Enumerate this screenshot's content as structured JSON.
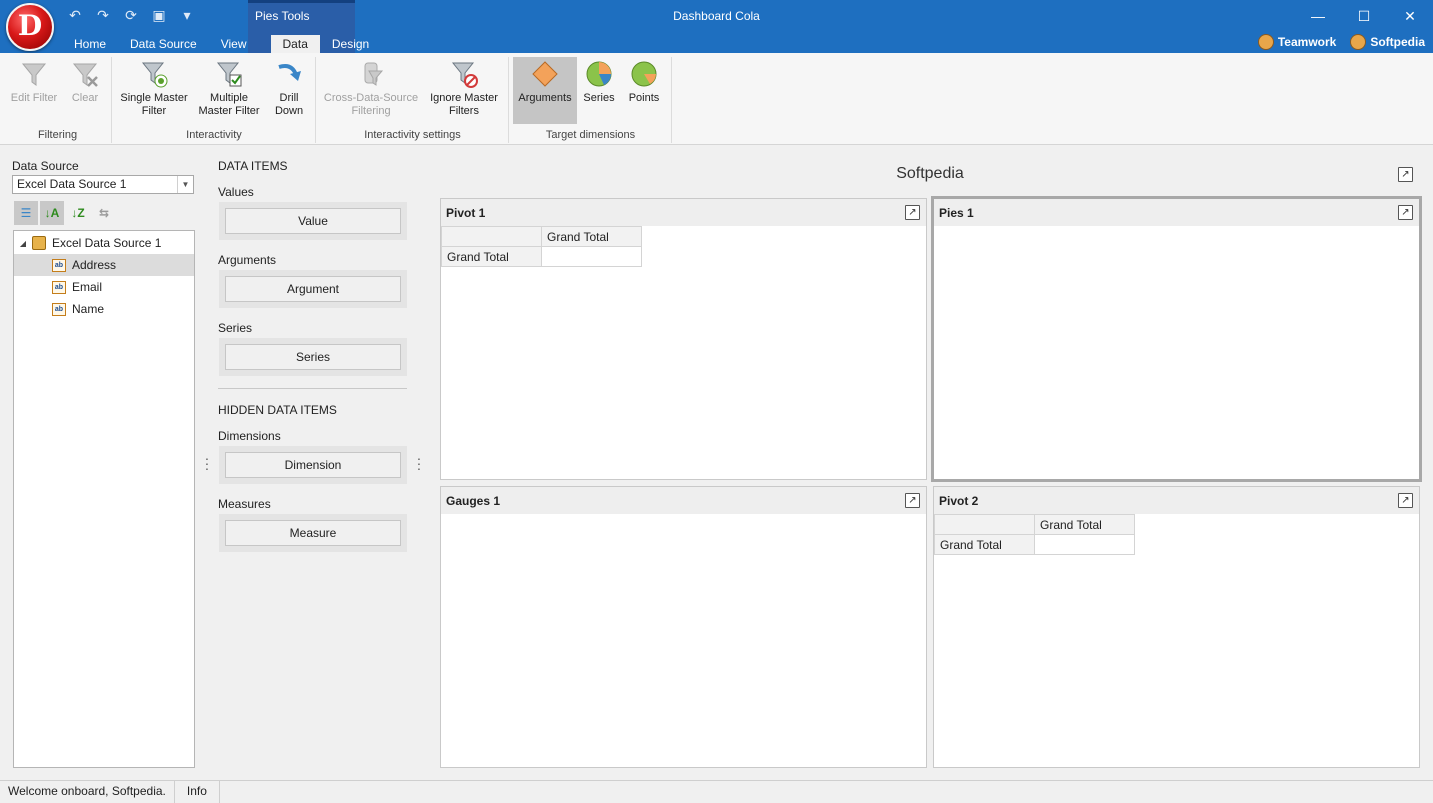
{
  "app": {
    "title": "Dashboard Cola",
    "logo_letter": "D",
    "context_group_label": "Pies Tools"
  },
  "tabs": [
    "Home",
    "Data Source",
    "View",
    "Data",
    "Design"
  ],
  "user_links": [
    "Teamwork",
    "Softpedia"
  ],
  "ribbon": {
    "groups": {
      "filtering": "Filtering",
      "interactivity": "Interactivity",
      "interactivity_settings": "Interactivity settings",
      "target_dimensions": "Target dimensions"
    },
    "buttons": {
      "edit_filter": "Edit Filter",
      "clear": "Clear",
      "single_master_filter": "Single Master Filter",
      "multiple_master_filter": "Multiple Master Filter",
      "drill_down": "Drill Down",
      "cross_data_source": "Cross-Data-Source Filtering",
      "ignore_master_filters": "Ignore Master Filters",
      "arguments": "Arguments",
      "series": "Series",
      "points": "Points"
    }
  },
  "data_source": {
    "label": "Data Source",
    "selected": "Excel Data Source 1",
    "tree_root": "Excel Data Source 1",
    "fields": [
      "Address",
      "Email",
      "Name"
    ],
    "selected_field": "Address"
  },
  "data_items": {
    "heading": "DATA ITEMS",
    "values_label": "Values",
    "values_slot": "Value",
    "arguments_label": "Arguments",
    "arguments_slot": "Argument",
    "series_label": "Series",
    "series_slot": "Series",
    "hidden_heading": "HIDDEN DATA ITEMS",
    "dimensions_label": "Dimensions",
    "dimensions_slot": "Dimension",
    "measures_label": "Measures",
    "measures_slot": "Measure"
  },
  "dashboard": {
    "title": "Softpedia",
    "panels": {
      "pivot1": {
        "title": "Pivot 1",
        "col_header": "Grand Total",
        "row_header": "Grand Total"
      },
      "pies1": {
        "title": "Pies 1"
      },
      "gauges1": {
        "title": "Gauges 1"
      },
      "pivot2": {
        "title": "Pivot 2",
        "col_header": "Grand Total",
        "row_header": "Grand Total"
      }
    }
  },
  "status": {
    "message": "Welcome onboard, Softpedia.",
    "info": "Info"
  }
}
